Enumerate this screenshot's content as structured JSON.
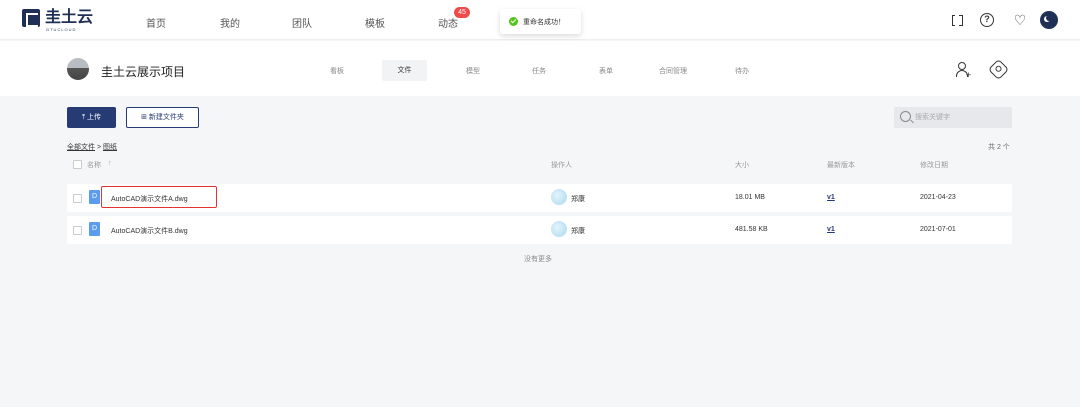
{
  "brand": {
    "name": "圭土云",
    "sub": "GTUCLOUD"
  },
  "nav": {
    "items": [
      "首页",
      "我的",
      "团队",
      "模板",
      "动态"
    ],
    "badge": "45"
  },
  "toast": {
    "text": "重命名成功！"
  },
  "project": {
    "title": "圭土云展示项目",
    "tabs": [
      "看板",
      "文件",
      "模型",
      "任务",
      "表单",
      "合同管理",
      "待办"
    ],
    "active_tab": "文件"
  },
  "toolbar": {
    "upload_label": "上传",
    "new_folder_label": "新建文件夹",
    "search_placeholder": "搜索关键字"
  },
  "breadcrumb": {
    "root": "全部文件",
    "sep": " > ",
    "current": "图纸"
  },
  "total": "共 2 个",
  "table": {
    "headers": {
      "name": "名称",
      "sort": "↑",
      "operator": "操作人",
      "size": "大小",
      "version": "最新版本",
      "date": "修改日期"
    },
    "rows": [
      {
        "icon": "D",
        "name": "AutoCAD演示文件A.dwg",
        "operator": "郑康",
        "size": "18.01 MB",
        "version": "v1",
        "date": "2021-04-23"
      },
      {
        "icon": "D",
        "name": "AutoCAD演示文件B.dwg",
        "operator": "郑康",
        "size": "481.58 KB",
        "version": "v1",
        "date": "2021-07-01"
      }
    ]
  },
  "footer": {
    "no_more": "没有更多"
  },
  "colors": {
    "primary": "#263a74",
    "badge": "#f04b4b",
    "success": "#52c41a",
    "highlight": "#e3342f",
    "file_icon": "#5b9bf0"
  }
}
